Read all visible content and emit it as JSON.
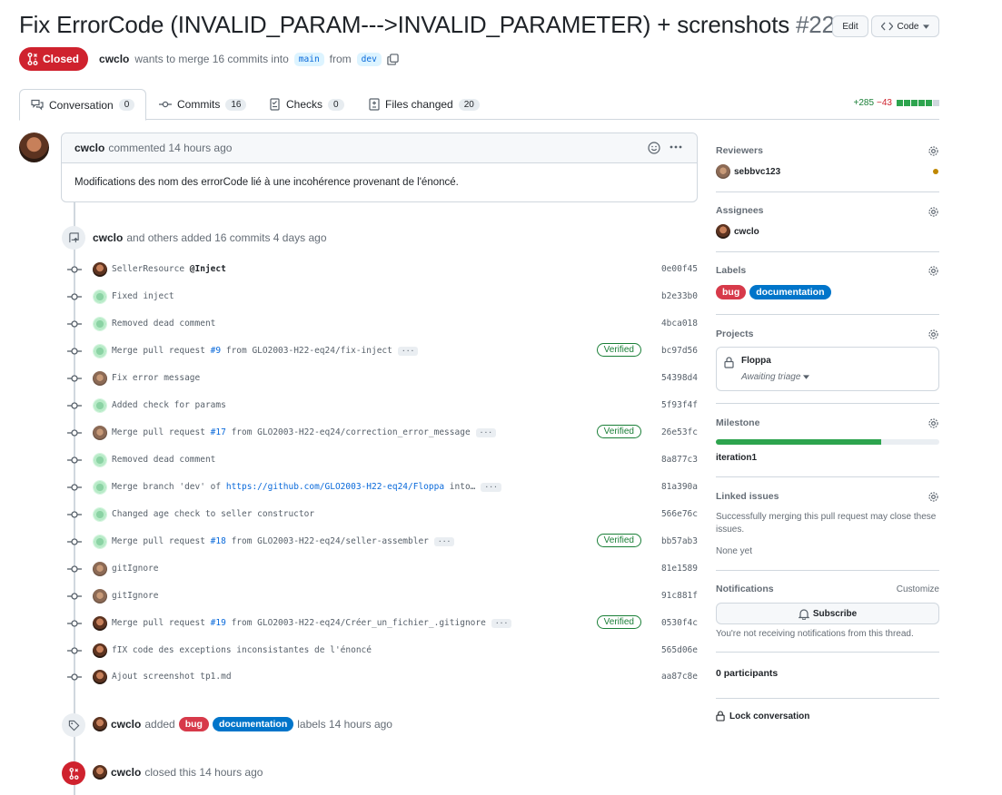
{
  "pr": {
    "title": "Fix ErrorCode (INVALID_PARAM--->INVALID_PARAMETER) + screnshots",
    "number": "#22",
    "edit_label": "Edit",
    "code_label": "Code",
    "state": "Closed",
    "author": "cwclo",
    "merge_text": "wants to merge 16 commits into",
    "base_branch": "main",
    "from_text": "from",
    "head_branch": "dev"
  },
  "tabs": [
    {
      "label": "Conversation",
      "count": "0"
    },
    {
      "label": "Commits",
      "count": "16"
    },
    {
      "label": "Checks",
      "count": "0"
    },
    {
      "label": "Files changed",
      "count": "20"
    }
  ],
  "diffstat": {
    "additions": "+285",
    "deletions": "−43",
    "colors": [
      "#2da44e",
      "#2da44e",
      "#2da44e",
      "#2da44e",
      "#2da44e",
      "#d0d7de"
    ]
  },
  "comment": {
    "author": "cwclo",
    "action": "commented 14 hours ago",
    "body": "Modifications des nom des errorCode lié à une incohérence provenant de l'énoncé."
  },
  "commits_event": {
    "author": "cwclo",
    "text": "and others added 16 commits 4 days ago"
  },
  "commits": [
    {
      "pre": "SellerResource ",
      "bold": "@Inject",
      "link": "",
      "post": "",
      "more": false,
      "verified": false,
      "sha": "0e00f45",
      "avatar": "dark"
    },
    {
      "pre": "Fixed inject",
      "bold": "",
      "link": "",
      "post": "",
      "more": false,
      "verified": false,
      "sha": "b2e33b0",
      "avatar": "green"
    },
    {
      "pre": "Removed dead comment",
      "bold": "",
      "link": "",
      "post": "",
      "more": false,
      "verified": false,
      "sha": "4bca018",
      "avatar": "green"
    },
    {
      "pre": "Merge pull request ",
      "bold": "",
      "link": "#9",
      "post": " from GLO2003-H22-eq24/fix-inject",
      "more": true,
      "verified": true,
      "sha": "bc97d56",
      "avatar": "green"
    },
    {
      "pre": "Fix error message",
      "bold": "",
      "link": "",
      "post": "",
      "more": false,
      "verified": false,
      "sha": "54398d4",
      "avatar": "brown"
    },
    {
      "pre": "Added check for params",
      "bold": "",
      "link": "",
      "post": "",
      "more": false,
      "verified": false,
      "sha": "5f93f4f",
      "avatar": "green"
    },
    {
      "pre": "Merge pull request ",
      "bold": "",
      "link": "#17",
      "post": " from GLO2003-H22-eq24/correction_error_message",
      "more": true,
      "verified": true,
      "sha": "26e53fc",
      "avatar": "brown"
    },
    {
      "pre": "Removed dead comment",
      "bold": "",
      "link": "",
      "post": "",
      "more": false,
      "verified": false,
      "sha": "8a877c3",
      "avatar": "green"
    },
    {
      "pre": "Merge branch 'dev' of ",
      "bold": "",
      "link": "https://github.com/GLO2003-H22-eq24/Floppa",
      "post": " into…",
      "more": true,
      "verified": false,
      "sha": "81a390a",
      "avatar": "green"
    },
    {
      "pre": "Changed age check to seller constructor",
      "bold": "",
      "link": "",
      "post": "",
      "more": false,
      "verified": false,
      "sha": "566e76c",
      "avatar": "green"
    },
    {
      "pre": "Merge pull request ",
      "bold": "",
      "link": "#18",
      "post": " from GLO2003-H22-eq24/seller-assembler",
      "more": true,
      "verified": true,
      "sha": "bb57ab3",
      "avatar": "green"
    },
    {
      "pre": "gitIgnore",
      "bold": "",
      "link": "",
      "post": "",
      "more": false,
      "verified": false,
      "sha": "81e1589",
      "avatar": "brown"
    },
    {
      "pre": "gitIgnore",
      "bold": "",
      "link": "",
      "post": "",
      "more": false,
      "verified": false,
      "sha": "91c881f",
      "avatar": "brown"
    },
    {
      "pre": "Merge pull request ",
      "bold": "",
      "link": "#19",
      "post": " from GLO2003-H22-eq24/Créer_un_fichier_.gitignore",
      "more": true,
      "verified": true,
      "sha": "0530f4c",
      "avatar": "dark"
    },
    {
      "pre": "fIX code des exceptions inconsistantes de l'énoncé",
      "bold": "",
      "link": "",
      "post": "",
      "more": false,
      "verified": false,
      "sha": "565d06e",
      "avatar": "dark"
    },
    {
      "pre": "Ajout screenshot tp1.md",
      "bold": "",
      "link": "",
      "post": "",
      "more": false,
      "verified": false,
      "sha": "aa87c8e",
      "avatar": "dark"
    }
  ],
  "verified_label": "Verified",
  "labels_event": {
    "author": "cwclo",
    "added": "added",
    "label1": "bug",
    "label2": "documentation",
    "suffix": "labels 14 hours ago"
  },
  "closed_event": {
    "author": "cwclo",
    "text": "closed this 14 hours ago"
  },
  "sidebar": {
    "reviewers": {
      "title": "Reviewers",
      "name": "sebbvc123",
      "status_color": "#bf8700"
    },
    "assignees": {
      "title": "Assignees",
      "name": "cwclo"
    },
    "labels": {
      "title": "Labels",
      "label1": "bug",
      "label2": "documentation"
    },
    "projects": {
      "title": "Projects",
      "name": "Floppa",
      "status": "Awaiting triage"
    },
    "milestone": {
      "title": "Milestone",
      "name": "iteration1",
      "progress": 0.74
    },
    "linked": {
      "title": "Linked issues",
      "text": "Successfully merging this pull request may close these issues.",
      "none": "None yet"
    },
    "notifications": {
      "title": "Notifications",
      "customize": "Customize",
      "subscribe": "Subscribe",
      "text": "You're not receiving notifications from this thread."
    },
    "participants": "0 participants",
    "lock": "Lock conversation"
  }
}
